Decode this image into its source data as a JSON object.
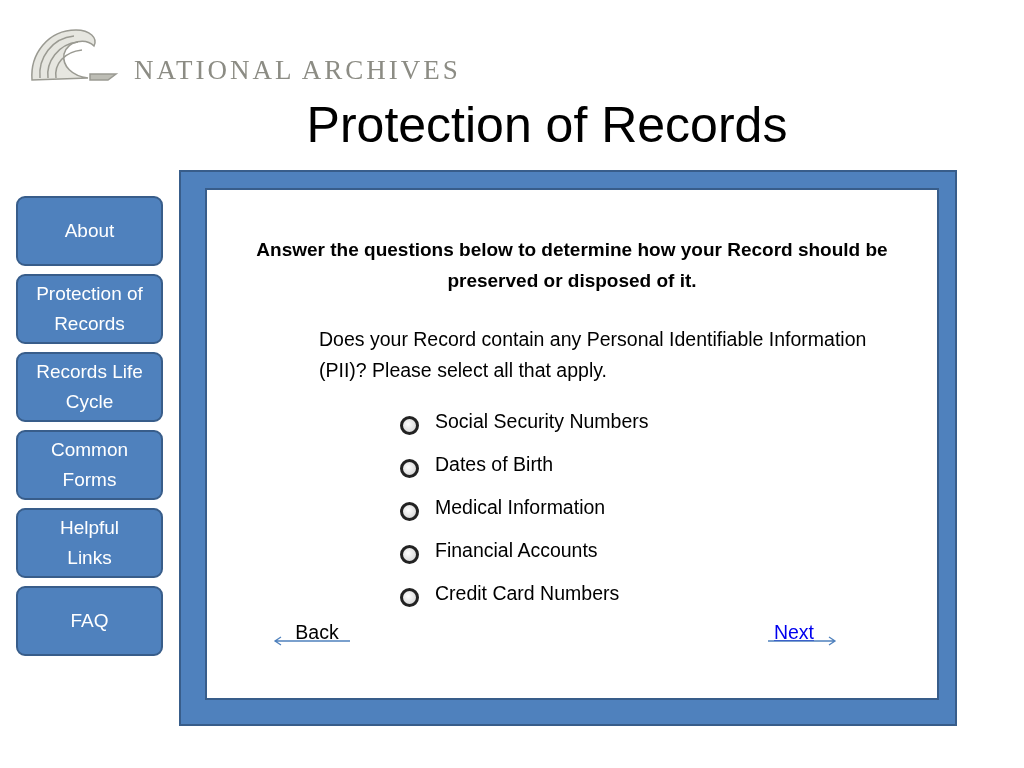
{
  "logo": {
    "text": "NATIONAL ARCHIVES"
  },
  "title": "Protection of Records",
  "sidebar": {
    "items": [
      {
        "label": "About"
      },
      {
        "label": "Protection of Records"
      },
      {
        "label": "Records Life Cycle"
      },
      {
        "label": "Common Forms"
      },
      {
        "label": "Helpful Links"
      },
      {
        "label": "FAQ"
      }
    ]
  },
  "panel": {
    "instructions": "Answer the questions below to determine how  your Record should be preserved or disposed of it.",
    "question": "Does your Record contain any Personal Identifiable Information (PII)? Please select all that apply.",
    "options": [
      {
        "label": "Social Security Numbers",
        "checked": false
      },
      {
        "label": "Dates of Birth",
        "checked": false
      },
      {
        "label": "Medical Information",
        "checked": false
      },
      {
        "label": "Financial Accounts",
        "checked": false
      },
      {
        "label": "Credit Card Numbers",
        "checked": false
      }
    ],
    "back": "Back",
    "next": "Next"
  }
}
